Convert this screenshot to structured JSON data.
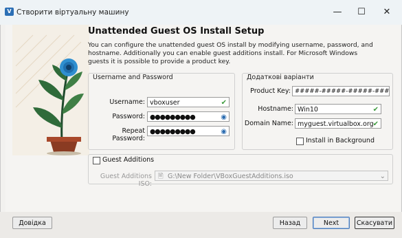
{
  "window": {
    "title": "Створити віртуальну машину",
    "app_icon_text": "V",
    "controls": {
      "minimize": "—",
      "maximize": "☐",
      "close": "✕"
    }
  },
  "heading": "Unattended Guest OS Install Setup",
  "description": "You can configure the unattended guest OS install by modifying username, password, and hostname. Additionally you can enable guest additions install. For Microsoft Windows guests it is possible to provide a product key.",
  "credentials": {
    "group_title": "Username and Password",
    "username_label": "Username:",
    "username_value": "vboxuser",
    "password_label": "Password:",
    "password_value": "●●●●●●●●●",
    "repeat_label": "Repeat Password:",
    "repeat_value": "●●●●●●●●●"
  },
  "extra": {
    "group_title": "Додаткові варіанти",
    "product_key_label": "Product Key:",
    "product_key_value": "#####-#####-#####-#####-#####",
    "hostname_label": "Hostname:",
    "hostname_value": "Win10",
    "domain_label": "Domain Name:",
    "domain_value": "myguest.virtualbox.org",
    "install_bg_label": "Install in Background"
  },
  "guest_additions": {
    "checkbox_label": "Guest Additions",
    "iso_label": "Guest Additions ISO:",
    "iso_value": "G:\\New Folder\\VBoxGuestAdditions.iso"
  },
  "icons": {
    "valid": "✔",
    "eye": "◉",
    "dropdown": "⌄",
    "file": "🖹"
  },
  "buttons": {
    "help": "Довідка",
    "back": "Назад",
    "next": "Next",
    "cancel": "Скасувати"
  },
  "colors": {
    "accent": "#2c6fb5",
    "valid": "#3c9a3c",
    "flower": "#2f8fd0"
  }
}
